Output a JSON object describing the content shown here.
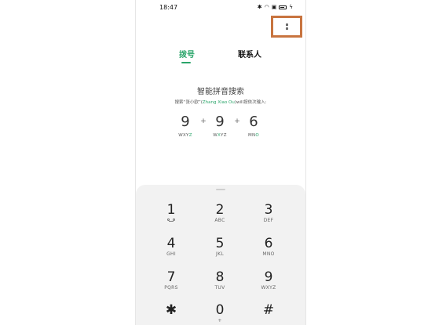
{
  "status_bar": {
    "time": "18:47",
    "icons": [
      "bluetooth-icon",
      "wifi-icon",
      "sim-icon",
      "battery-icon",
      "charging-icon"
    ]
  },
  "tabs": [
    {
      "label": "拨号",
      "active": true
    },
    {
      "label": "联系人",
      "active": false
    }
  ],
  "hint": {
    "title": "智能拼音搜索",
    "desc_prefix": "搜索“张小欧”(",
    "pinyin": "Zhang Xiao Ou",
    "desc_suffix": ")will按依次输入:"
  },
  "example": {
    "digits": [
      "9",
      "9",
      "6"
    ],
    "plus": "+",
    "letters": [
      {
        "pre": "WXY",
        "hl": "Z",
        "post": ""
      },
      {
        "pre": "W",
        "hl": "X",
        "post": "YZ"
      },
      {
        "pre": "MN",
        "hl": "O",
        "post": ""
      }
    ]
  },
  "keypad": {
    "keys": [
      {
        "num": "1",
        "sub": ""
      },
      {
        "num": "2",
        "sub": "ABC"
      },
      {
        "num": "3",
        "sub": "DEF"
      },
      {
        "num": "4",
        "sub": "GHI"
      },
      {
        "num": "5",
        "sub": "JKL"
      },
      {
        "num": "6",
        "sub": "MNO"
      },
      {
        "num": "7",
        "sub": "PQRS"
      },
      {
        "num": "8",
        "sub": "TUV"
      },
      {
        "num": "9",
        "sub": "WXYZ"
      },
      {
        "num": "✱",
        "sub": ""
      },
      {
        "num": "0",
        "sub": "+"
      },
      {
        "num": "#",
        "sub": ""
      }
    ]
  },
  "colors": {
    "accent": "#2aa56a",
    "highlight_box": "#c8743f",
    "keypad_bg": "#f2f2f2"
  }
}
